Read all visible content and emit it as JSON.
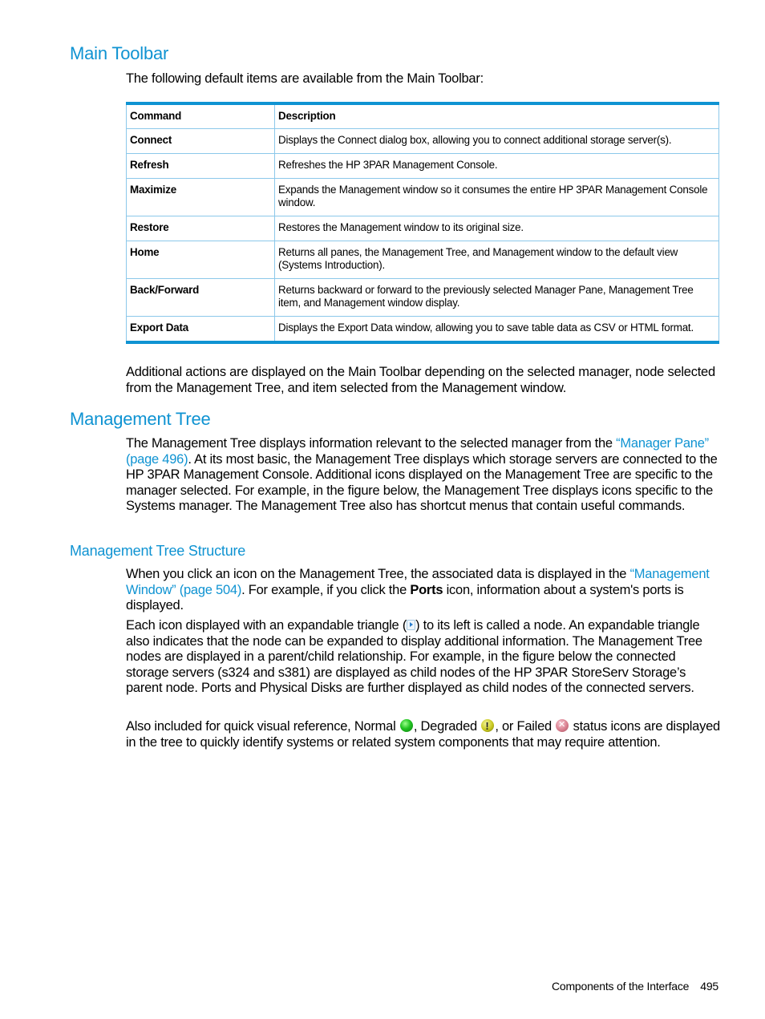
{
  "sections": {
    "main_toolbar": {
      "heading": "Main Toolbar",
      "intro": "The following default items are available from the Main Toolbar:",
      "table": {
        "headers": [
          "Command",
          "Description"
        ],
        "rows": [
          {
            "command": "Connect",
            "description": "Displays the Connect dialog box, allowing you to connect additional storage server(s)."
          },
          {
            "command": "Refresh",
            "description": "Refreshes the HP 3PAR Management Console."
          },
          {
            "command": "Maximize",
            "description": "Expands the Management window so it consumes the entire HP 3PAR Management Console window."
          },
          {
            "command": "Restore",
            "description": "Restores the Management window to its original size."
          },
          {
            "command": "Home",
            "description": "Returns all panes, the Management Tree, and Management window to the default view (Systems Introduction)."
          },
          {
            "command": "Back/Forward",
            "description": "Returns backward or forward to the previously selected Manager Pane, Management Tree item, and Management window display."
          },
          {
            "command": "Export Data",
            "description": "Displays the Export Data window, allowing you to save table data as CSV or HTML format."
          }
        ]
      },
      "additional": "Additional actions are displayed on the Main Toolbar depending on the selected manager, node selected from the Management Tree, and item selected from the Management window."
    },
    "management_tree": {
      "heading": "Management Tree",
      "p1_before": "The Management Tree displays information relevant to the selected manager from the ",
      "p1_link": "“Manager Pane” (page 496)",
      "p1_after": ". At its most basic, the Management Tree displays which storage servers are connected to the HP 3PAR Management Console. Additional icons displayed on the Management Tree are specific to the manager selected. For example, in the figure below, the Management Tree displays icons specific to the Systems manager. The Management Tree also has shortcut menus that contain useful commands."
    },
    "management_tree_structure": {
      "heading": "Management Tree Structure",
      "p1_before": "When you click an icon on the Management Tree, the associated data is displayed in the ",
      "p1_link": "“Management Window” (page 504)",
      "p1_mid": ". For example, if you click the ",
      "p1_bold": "Ports",
      "p1_after": " icon, information about a system's ports is displayed.",
      "p2_before": "Each icon displayed with an expandable triangle (",
      "p2_after": ") to its left is called a node. An expandable triangle also indicates that the node can be expanded to display additional information. The Management Tree nodes are displayed in a parent/child relationship. For example, in the figure below the connected storage servers (s324 and s381) are displayed as child nodes of the HP 3PAR StoreServ Storage’s parent node. Ports and Physical Disks are further displayed as child nodes of the connected servers.",
      "p3_a": "Also included for quick visual reference, Normal ",
      "p3_b": ", Degraded ",
      "p3_c": ", or Failed ",
      "p3_d": " status icons are displayed in the tree to quickly identify systems or related system components that may require attention."
    }
  },
  "footer": {
    "section_title": "Components of the Interface",
    "page_number": "495"
  },
  "colors": {
    "heading": "#0f93d2",
    "table_rule": "#0f93d2",
    "table_grid": "#8cc8ea"
  }
}
